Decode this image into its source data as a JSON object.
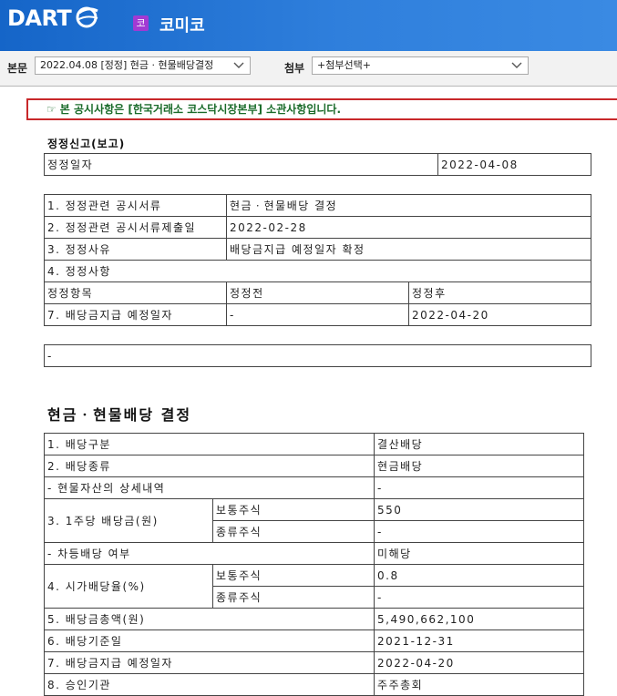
{
  "header": {
    "logo": "DART",
    "company_badge": "코",
    "company_name": "코미코"
  },
  "toolbar": {
    "main_label": "본문",
    "main_select": "2022.04.08  [정정] 현금 · 현물배당결정",
    "attach_label": "첨부",
    "attach_select": "+첨부선택+"
  },
  "notice": "본 공시사항은 [한국거래소 코스닥시장본부] 소관사항입니다.",
  "correction": {
    "title": "정정신고(보고)",
    "date_label": "정정일자",
    "date_value": "2022-04-08",
    "rows": [
      {
        "label": "1. 정정관련 공시서류",
        "value": "현금ㆍ현물배당 결정"
      },
      {
        "label": "2. 정정관련 공시서류제출일",
        "value": "2022-02-28"
      },
      {
        "label": "3. 정정사유",
        "value": "배당금지급 예정일자 확정"
      }
    ],
    "items_header": "4. 정정사항",
    "col_item": "정정항목",
    "col_before": "정정전",
    "col_after": "정정후",
    "item_row": {
      "item": "7. 배당금지급 예정일자",
      "before": "-",
      "after": "2022-04-20"
    },
    "remark": "-"
  },
  "dividend": {
    "title": "현금ㆍ현물배당 결정",
    "type_label": "1. 배당구분",
    "type_value": "결산배당",
    "kind_label": "2. 배당종류",
    "kind_value": "현금배당",
    "asset_label": "- 현물자산의 상세내역",
    "asset_value": "-",
    "per_share_label": "3. 1주당 배당금(원)",
    "common_label": "보통주식",
    "per_share_common": "550",
    "preferred_label": "종류주식",
    "per_share_preferred": "-",
    "diff_label": "- 차등배당 여부",
    "diff_value": "미해당",
    "yield_label": "4. 시가배당율(%)",
    "yield_common_label": "보통주식",
    "yield_common": "0.8",
    "yield_preferred_label": "종류주식",
    "yield_preferred": "-",
    "total_label": "5. 배당금총액(원)",
    "total_value": "5,490,662,100",
    "record_label": "6. 배당기준일",
    "record_value": "2021-12-31",
    "pay_label": "7. 배당금지급 예정일자",
    "pay_value": "2022-04-20",
    "approval_label": "8. 승인기관",
    "approval_value": "주주총회"
  }
}
